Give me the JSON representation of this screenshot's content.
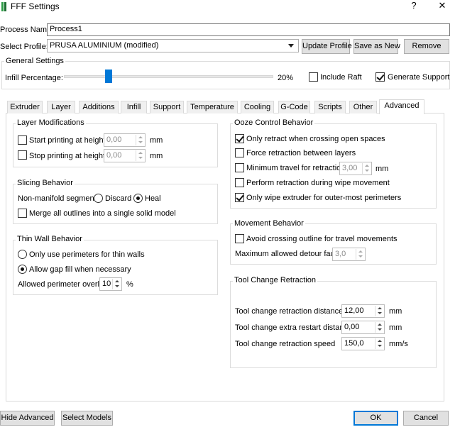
{
  "window": {
    "title": "FFF Settings",
    "help_glyph": "?",
    "close_glyph": "✕",
    "app_icon": "simplify3d-app-icon"
  },
  "process_name": {
    "label": "Process Name:",
    "value": "Process1"
  },
  "select_profile": {
    "label": "Select Profile:",
    "value": "PRUSA ALUMINIUM (modified)",
    "update_label": "Update Profile",
    "save_as_new_label": "Save as New",
    "remove_label": "Remove"
  },
  "general_settings": {
    "title": "General Settings",
    "infill_label": "Infill Percentage:",
    "infill_percent": 20,
    "infill_value_text": "20%",
    "include_raft": {
      "label": "Include Raft",
      "checked": false
    },
    "generate_support": {
      "label": "Generate Support",
      "checked": true
    }
  },
  "tabs": [
    {
      "label": "Extruder",
      "active": false
    },
    {
      "label": "Layer",
      "active": false
    },
    {
      "label": "Additions",
      "active": false
    },
    {
      "label": "Infill",
      "active": false
    },
    {
      "label": "Support",
      "active": false
    },
    {
      "label": "Temperature",
      "active": false
    },
    {
      "label": "Cooling",
      "active": false
    },
    {
      "label": "G-Code",
      "active": false
    },
    {
      "label": "Scripts",
      "active": false
    },
    {
      "label": "Other",
      "active": false
    },
    {
      "label": "Advanced",
      "active": true
    }
  ],
  "layer_modifications": {
    "title": "Layer Modifications",
    "start": {
      "label": "Start printing at height",
      "checked": false,
      "value": "0,00",
      "unit": "mm"
    },
    "stop": {
      "label": "Stop printing at height",
      "checked": false,
      "value": "0,00",
      "unit": "mm"
    }
  },
  "slicing_behavior": {
    "title": "Slicing Behavior",
    "non_manifold_label": "Non-manifold segments:",
    "discard": {
      "label": "Discard",
      "selected": false
    },
    "heal": {
      "label": "Heal",
      "selected": true
    },
    "merge": {
      "label": "Merge all outlines into a single solid model",
      "checked": false
    }
  },
  "thin_wall_behavior": {
    "title": "Thin Wall Behavior",
    "only_perimeters": {
      "label": "Only use perimeters for thin walls",
      "selected": false
    },
    "allow_gap_fill": {
      "label": "Allow gap fill when necessary",
      "selected": true
    },
    "overlap_label": "Allowed perimeter overlap",
    "overlap_value": "10",
    "overlap_unit": "%"
  },
  "ooze_control": {
    "title": "Ooze Control Behavior",
    "only_retract": {
      "label": "Only retract when crossing open spaces",
      "checked": true
    },
    "force_retraction": {
      "label": "Force retraction between layers",
      "checked": false
    },
    "min_travel": {
      "label": "Minimum travel for retraction",
      "checked": false,
      "value": "3,00",
      "unit": "mm"
    },
    "perform_retraction": {
      "label": "Perform retraction during wipe movement",
      "checked": false
    },
    "only_wipe": {
      "label": "Only wipe extruder for outer-most perimeters",
      "checked": true
    }
  },
  "movement_behavior": {
    "title": "Movement Behavior",
    "avoid_crossing": {
      "label": "Avoid crossing outline for travel movements",
      "checked": false
    },
    "max_detour_label": "Maximum allowed detour factor",
    "max_detour_value": "3,0"
  },
  "tool_change_retraction": {
    "title": "Tool Change Retraction",
    "distance": {
      "label": "Tool change retraction distance",
      "value": "12,00",
      "unit": "mm"
    },
    "extra_restart": {
      "label": "Tool change extra restart distance",
      "value": "0,00",
      "unit": "mm"
    },
    "speed": {
      "label": "Tool change retraction speed",
      "value": "150,0",
      "unit": "mm/s"
    }
  },
  "footer": {
    "hide_advanced_label": "Hide Advanced",
    "select_models_label": "Select Models",
    "ok_label": "OK",
    "cancel_label": "Cancel"
  },
  "colors": {
    "accent": "#0078d7",
    "check_green": "#2e9c47"
  }
}
